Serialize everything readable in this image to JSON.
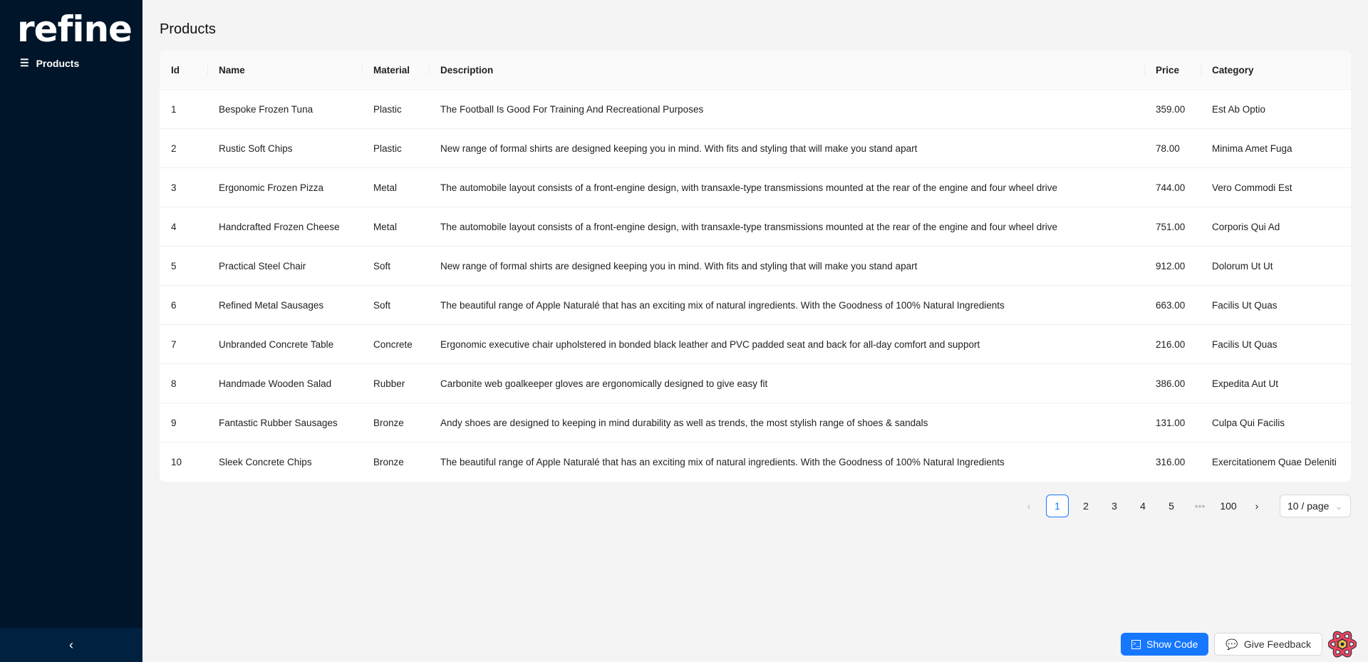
{
  "sidebar": {
    "logo": "refine",
    "items": [
      {
        "label": "Products",
        "icon": "unordered-list-icon"
      }
    ],
    "collapse_icon": "chevron-left-icon"
  },
  "page": {
    "title": "Products"
  },
  "table": {
    "columns": [
      "Id",
      "Name",
      "Material",
      "Description",
      "Price",
      "Category"
    ],
    "rows": [
      [
        "1",
        "Bespoke Frozen Tuna",
        "Plastic",
        "The Football Is Good For Training And Recreational Purposes",
        "359.00",
        "Est Ab Optio"
      ],
      [
        "2",
        "Rustic Soft Chips",
        "Plastic",
        "New range of formal shirts are designed keeping you in mind. With fits and styling that will make you stand apart",
        "78.00",
        "Minima Amet Fuga"
      ],
      [
        "3",
        "Ergonomic Frozen Pizza",
        "Metal",
        "The automobile layout consists of a front-engine design, with transaxle-type transmissions mounted at the rear of the engine and four wheel drive",
        "744.00",
        "Vero Commodi Est"
      ],
      [
        "4",
        "Handcrafted Frozen Cheese",
        "Metal",
        "The automobile layout consists of a front-engine design, with transaxle-type transmissions mounted at the rear of the engine and four wheel drive",
        "751.00",
        "Corporis Qui Ad"
      ],
      [
        "5",
        "Practical Steel Chair",
        "Soft",
        "New range of formal shirts are designed keeping you in mind. With fits and styling that will make you stand apart",
        "912.00",
        "Dolorum Ut Ut"
      ],
      [
        "6",
        "Refined Metal Sausages",
        "Soft",
        "The beautiful range of Apple Naturalé that has an exciting mix of natural ingredients. With the Goodness of 100% Natural Ingredients",
        "663.00",
        "Facilis Ut Quas"
      ],
      [
        "7",
        "Unbranded Concrete Table",
        "Concrete",
        "Ergonomic executive chair upholstered in bonded black leather and PVC padded seat and back for all-day comfort and support",
        "216.00",
        "Facilis Ut Quas"
      ],
      [
        "8",
        "Handmade Wooden Salad",
        "Rubber",
        "Carbonite web goalkeeper gloves are ergonomically designed to give easy fit",
        "386.00",
        "Expedita Aut Ut"
      ],
      [
        "9",
        "Fantastic Rubber Sausages",
        "Bronze",
        "Andy shoes are designed to keeping in mind durability as well as trends, the most stylish range of shoes & sandals",
        "131.00",
        "Culpa Qui Facilis"
      ],
      [
        "10",
        "Sleek Concrete Chips",
        "Bronze",
        "The beautiful range of Apple Naturalé that has an exciting mix of natural ingredients. With the Goodness of 100% Natural Ingredients",
        "316.00",
        "Exercitationem Quae Deleniti"
      ]
    ]
  },
  "pagination": {
    "prev": "‹",
    "pages": [
      "1",
      "2",
      "3",
      "4",
      "5"
    ],
    "ellipsis": "•••",
    "last": "100",
    "next": "›",
    "current": "1",
    "page_size": "10 / page"
  },
  "footer": {
    "show_code": "Show Code",
    "give_feedback": "Give Feedback"
  },
  "colors": {
    "sidebar": "#001529",
    "primary": "#1677ff"
  }
}
